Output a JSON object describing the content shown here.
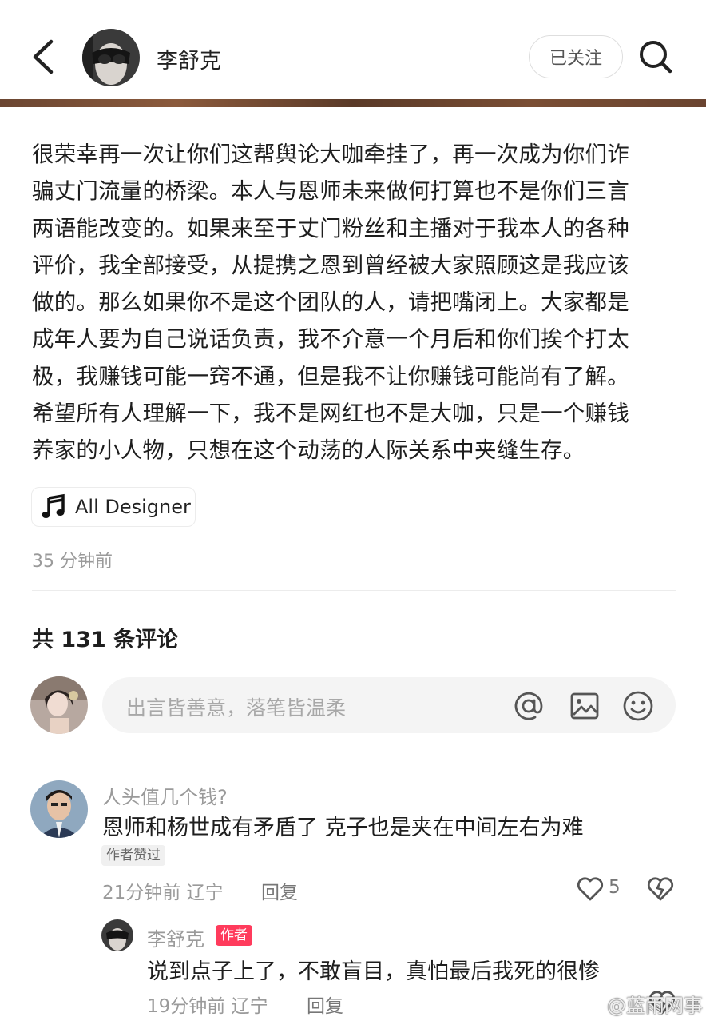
{
  "header": {
    "author_name": "李舒克",
    "follow_label": "已关注"
  },
  "post": {
    "lines": [
      "很荣幸再一次让你们这帮舆论大咖牵挂了，再一次成为你们诈",
      "骗丈门流量的桥梁。本人与恩师未来做何打算也不是你们三言",
      "两语能改变的。如果来至于丈门粉丝和主播对于我本人的各种",
      "评价，我全部接受，从提携之恩到曾经被大家照顾这是我应该",
      "做的。那么如果你不是这个团队的人，请把嘴闭上。大家都是",
      "成年人要为自己说话负责，我不介意一个月后和你们挨个打太",
      "极，我赚钱可能一窍不通，但是我不让你赚钱可能尚有了解。",
      "希望所有人理解一下，我不是网红也不是大咖，只是一个赚钱",
      "养家的小人物，只想在这个动荡的人际关系中夹缝生存。"
    ],
    "music_label": "All Designer",
    "time": "35 分钟前"
  },
  "comments_section": {
    "count_label": "共 131 条评论",
    "input_placeholder": "出言皆善意，落笔皆温柔"
  },
  "comment1": {
    "name": "人头值几个钱?",
    "text": "恩师和杨世成有矛盾了 克子也是夹在中间左右为难",
    "badge": "作者赞过",
    "meta": "21分钟前 辽宁",
    "reply_label": "回复",
    "like_count": "5"
  },
  "reply1": {
    "name": "李舒克",
    "badge": "作者",
    "text": "说到点子上了，不敢盲目，真怕最后我死的很惨",
    "meta": "19分钟前 辽宁",
    "reply_label": "回复"
  },
  "watermark": {
    "text": "@蓝雨网事"
  }
}
